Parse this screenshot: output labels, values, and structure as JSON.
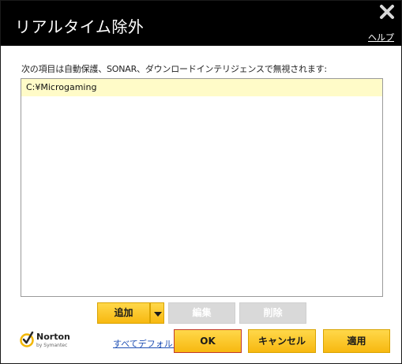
{
  "window": {
    "title": "リアルタイム除外",
    "help_label": "ヘルプ",
    "close_icon": "close-icon"
  },
  "main": {
    "description": "次の項目は自動保護、SONAR、ダウンロードインテリジェンスで無視されます:",
    "items": [
      "C:¥Microgaming"
    ]
  },
  "actions": {
    "add_label": "追加",
    "edit_label": "編集",
    "delete_label": "削除"
  },
  "footer": {
    "brand": "Norton",
    "brand_sub": "by Symantec",
    "defaults_label": "すべてデフォルト",
    "ok_label": "OK",
    "cancel_label": "キャンセル",
    "apply_label": "適用"
  },
  "colors": {
    "accent": "#f7c325",
    "titlebar": "#000000",
    "selected_row": "#fffbc8",
    "ok_border": "#c0392b"
  }
}
